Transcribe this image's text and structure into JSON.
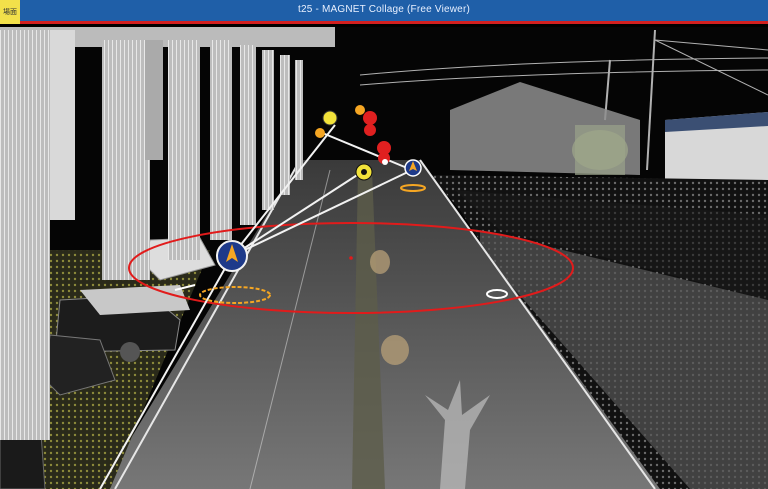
{
  "window": {
    "title": "t25 - MAGNET Collage (Free Viewer)",
    "app_icon_label": "場面"
  },
  "viewport": {
    "scene": "point-cloud-street",
    "colors": {
      "titlebar": "#1f5fa8",
      "titlebar_border": "#d21f1f",
      "measure_ellipse": "#e11b1b",
      "camera_marker": "#1e3a8a",
      "marker_orange": "#f5a623",
      "marker_red": "#e02020",
      "marker_yellow": "#f2e23a"
    },
    "icons": [
      "camera-position-icon",
      "photo-marker-icon"
    ]
  }
}
